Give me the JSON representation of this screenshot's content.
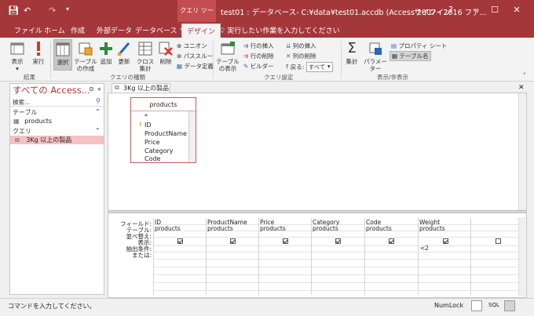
{
  "titlebar": {
    "context_label": "クエリ ツール",
    "title": "test01 : データベース- C:¥data¥test01.accdb (Access 2007 - 2016 ファ...",
    "signin": "サインイン",
    "help": "?",
    "min": "─",
    "max": "☐",
    "close": "✕"
  },
  "tabs": [
    "ファイル",
    "ホーム",
    "作成",
    "外部データ",
    "データベース ツール",
    "デザイン"
  ],
  "tell_me": "実行したい作業を入力してください",
  "ribbon": {
    "results": {
      "view": "表示",
      "run": "実行",
      "group": "結果"
    },
    "query_type": {
      "select": "選択",
      "make_table": "テーブルの作成",
      "append": "追加",
      "update": "更新",
      "crosstab": "クロス集計",
      "delete": "削除",
      "union": "ユニオン",
      "pass_through": "パススルー",
      "data_definition": "データ定義",
      "group": "クエリの種類"
    },
    "query_setup": {
      "show_table": "テーブルの表示",
      "insert_rows": "行の挿入",
      "delete_rows": "行の削除",
      "builder": "ビルダー",
      "insert_columns": "列の挿入",
      "delete_columns": "列の削除",
      "return_label": "戻る:",
      "return_value": "すべて",
      "group": "クエリ設定"
    },
    "show_hide": {
      "totals": "集計",
      "parameters": "パラメーター",
      "property_sheet": "プロパティ シート",
      "table_names": "テーブル名",
      "group": "表示/非表示"
    }
  },
  "nav": {
    "title": "すべての Access...",
    "search_placeholder": "検索...",
    "sections": [
      {
        "label": "テーブル",
        "items": [
          "products"
        ]
      },
      {
        "label": "クエリ",
        "items": [
          "3Kg 以上の製品"
        ]
      }
    ]
  },
  "document_tab": "3Kg 以上の製品",
  "field_list": {
    "table": "products",
    "fields": [
      "*",
      "ID",
      "ProductName",
      "Price",
      "Category",
      "Code"
    ]
  },
  "qbe": {
    "row_labels": [
      "フィールド:",
      "テーブル:",
      "並べ替え:",
      "表示:",
      "抽出条件:",
      "または:"
    ],
    "columns": [
      {
        "field": "ID",
        "table": "products",
        "show": true,
        "criteria": ""
      },
      {
        "field": "ProductName",
        "table": "products",
        "show": true,
        "criteria": ""
      },
      {
        "field": "Price",
        "table": "products",
        "show": true,
        "criteria": ""
      },
      {
        "field": "Category",
        "table": "products",
        "show": true,
        "criteria": ""
      },
      {
        "field": "Code",
        "table": "products",
        "show": true,
        "criteria": ""
      },
      {
        "field": "Weight",
        "table": "products",
        "show": true,
        "criteria": "<2"
      },
      {
        "field": "",
        "table": "",
        "show": false,
        "criteria": ""
      }
    ]
  },
  "status": {
    "message": "コマンドを入力してください。",
    "numlock": "NumLock",
    "sql": "SQL"
  }
}
